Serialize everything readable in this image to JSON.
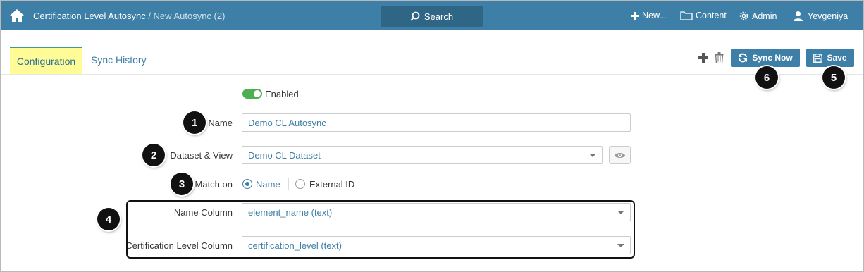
{
  "header": {
    "breadcrumb_root": "Certification Level Autosync",
    "breadcrumb_separator": " / ",
    "breadcrumb_current": "New Autosync (2)",
    "search_label": "Search",
    "new_label": "New...",
    "content_label": "Content",
    "admin_label": "Admin",
    "user_label": "Yevgeniya"
  },
  "tabs": [
    {
      "label": "Configuration",
      "active": true
    },
    {
      "label": "Sync History",
      "active": false
    }
  ],
  "toolbar": {
    "sync_now_label": "Sync Now",
    "save_label": "Save"
  },
  "callouts": [
    "1",
    "2",
    "3",
    "4",
    "5",
    "6"
  ],
  "form": {
    "enabled_label": "Enabled",
    "enabled": true,
    "name_label": "Name",
    "name_value": "Demo CL Autosync",
    "dataset_label": "Dataset & View",
    "dataset_value": "Demo CL Dataset",
    "match_label": "Match on",
    "match_options": [
      "Name",
      "External ID"
    ],
    "match_selected": "Name",
    "name_column_label": "Name Column",
    "name_column_value": "element_name (text)",
    "cert_column_label": "Certification Level Column",
    "cert_column_value": "certification_level (text)"
  },
  "colors": {
    "header_bg": "#3d7fa6",
    "search_bg": "#2f6585",
    "active_tab_bg": "#fffb96",
    "toggle_on": "#4caf50",
    "link_text": "#3d7fa6"
  },
  "icons": [
    "home-icon",
    "search-icon",
    "plus-icon",
    "folder-icon",
    "gear-icon",
    "user-icon",
    "trash-icon",
    "refresh-icon",
    "floppy-disk-icon",
    "eye-icon",
    "chevron-down-icon"
  ]
}
